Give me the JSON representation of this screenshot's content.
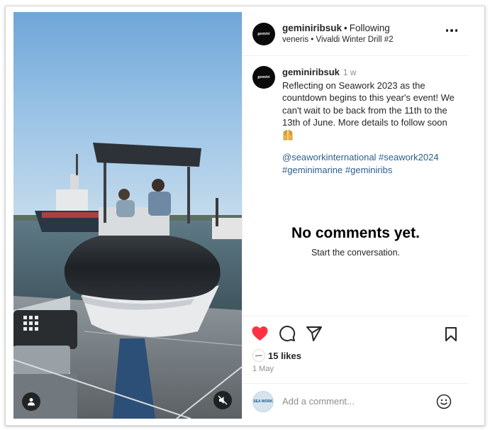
{
  "post": {
    "author": "geminiribsuk",
    "author_logo_text": "gemini",
    "follow_status": "Following",
    "separator": "•",
    "audio_artist": "veneris",
    "audio_title": "Vivaldi Winter Drill #2",
    "caption_time": "1 w",
    "caption_text": "Reflecting on Seawork 2023 as the countdown begins to this year's event! We can't wait to be back from the 11th to the 13th of June. More details to follow soon",
    "caption_emoji": "raised-hands-emoji",
    "hashtags_line1": "@seaworkinternational #seawork2024",
    "hashtags_line2": "#geminimarine #geminiribs",
    "likes": "15 likes",
    "date": "1 May"
  },
  "comments": {
    "empty_title": "No comments yet.",
    "empty_subtitle": "Start the conversation.",
    "input_placeholder": "Add a comment...",
    "commenter_logo_text": "SEA WORK"
  },
  "icons": {
    "like": "heart-icon",
    "comment": "comment-icon",
    "share": "send-icon",
    "save": "bookmark-icon",
    "more": "more-icon",
    "emoji": "emoji-icon",
    "mute": "muted-speaker-icon",
    "tags": "user-tag-icon"
  },
  "colors": {
    "like_red": "#ff3040",
    "hashtag_blue": "#2c5f8d",
    "muted_text": "#8e8e8e",
    "border": "#efefef"
  }
}
